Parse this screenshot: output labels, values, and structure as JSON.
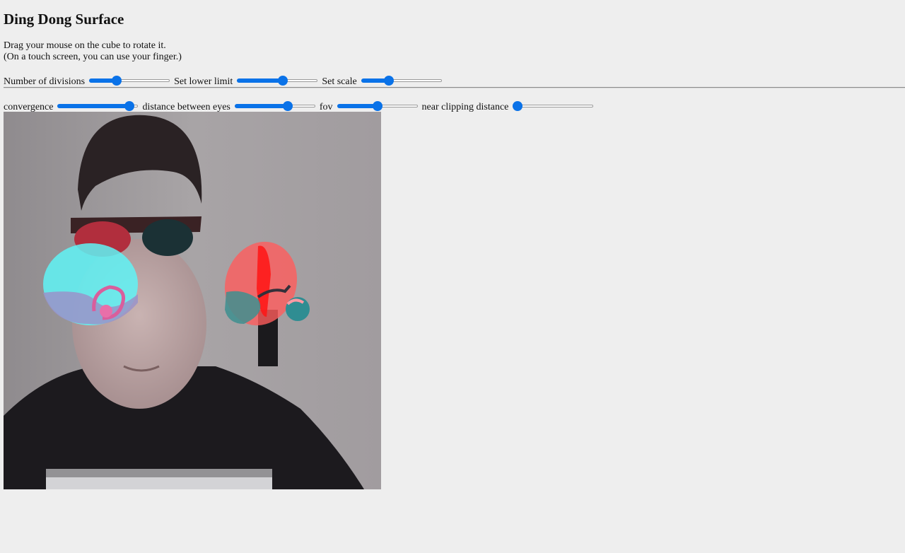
{
  "page": {
    "title": "Ding Dong Surface",
    "instructions_line1": "Drag your mouse on the cube to rotate it.",
    "instructions_line2": "(On a touch screen, you can use your finger.)"
  },
  "controls_row1": [
    {
      "label": "Number of divisions",
      "value_fraction": 0.32
    },
    {
      "label": "Set lower limit",
      "value_fraction": 0.58
    },
    {
      "label": "Set scale",
      "value_fraction": 0.32
    }
  ],
  "controls_row2": [
    {
      "label": "convergence",
      "value_fraction": 0.95
    },
    {
      "label": "distance between eyes",
      "value_fraction": 0.68
    },
    {
      "label": "fov",
      "value_fraction": 0.5
    },
    {
      "label": "near clipping distance",
      "value_fraction": 0.0
    }
  ],
  "colors": {
    "slider_accent": "#0a72e8",
    "background": "#eeeeee",
    "anaglyph_cyan": "#5ff3f6",
    "anaglyph_red": "#ff5c5c"
  },
  "viewport": {
    "content": "webcam feed with anaglyph 3D Ding Dong surface overlay"
  }
}
